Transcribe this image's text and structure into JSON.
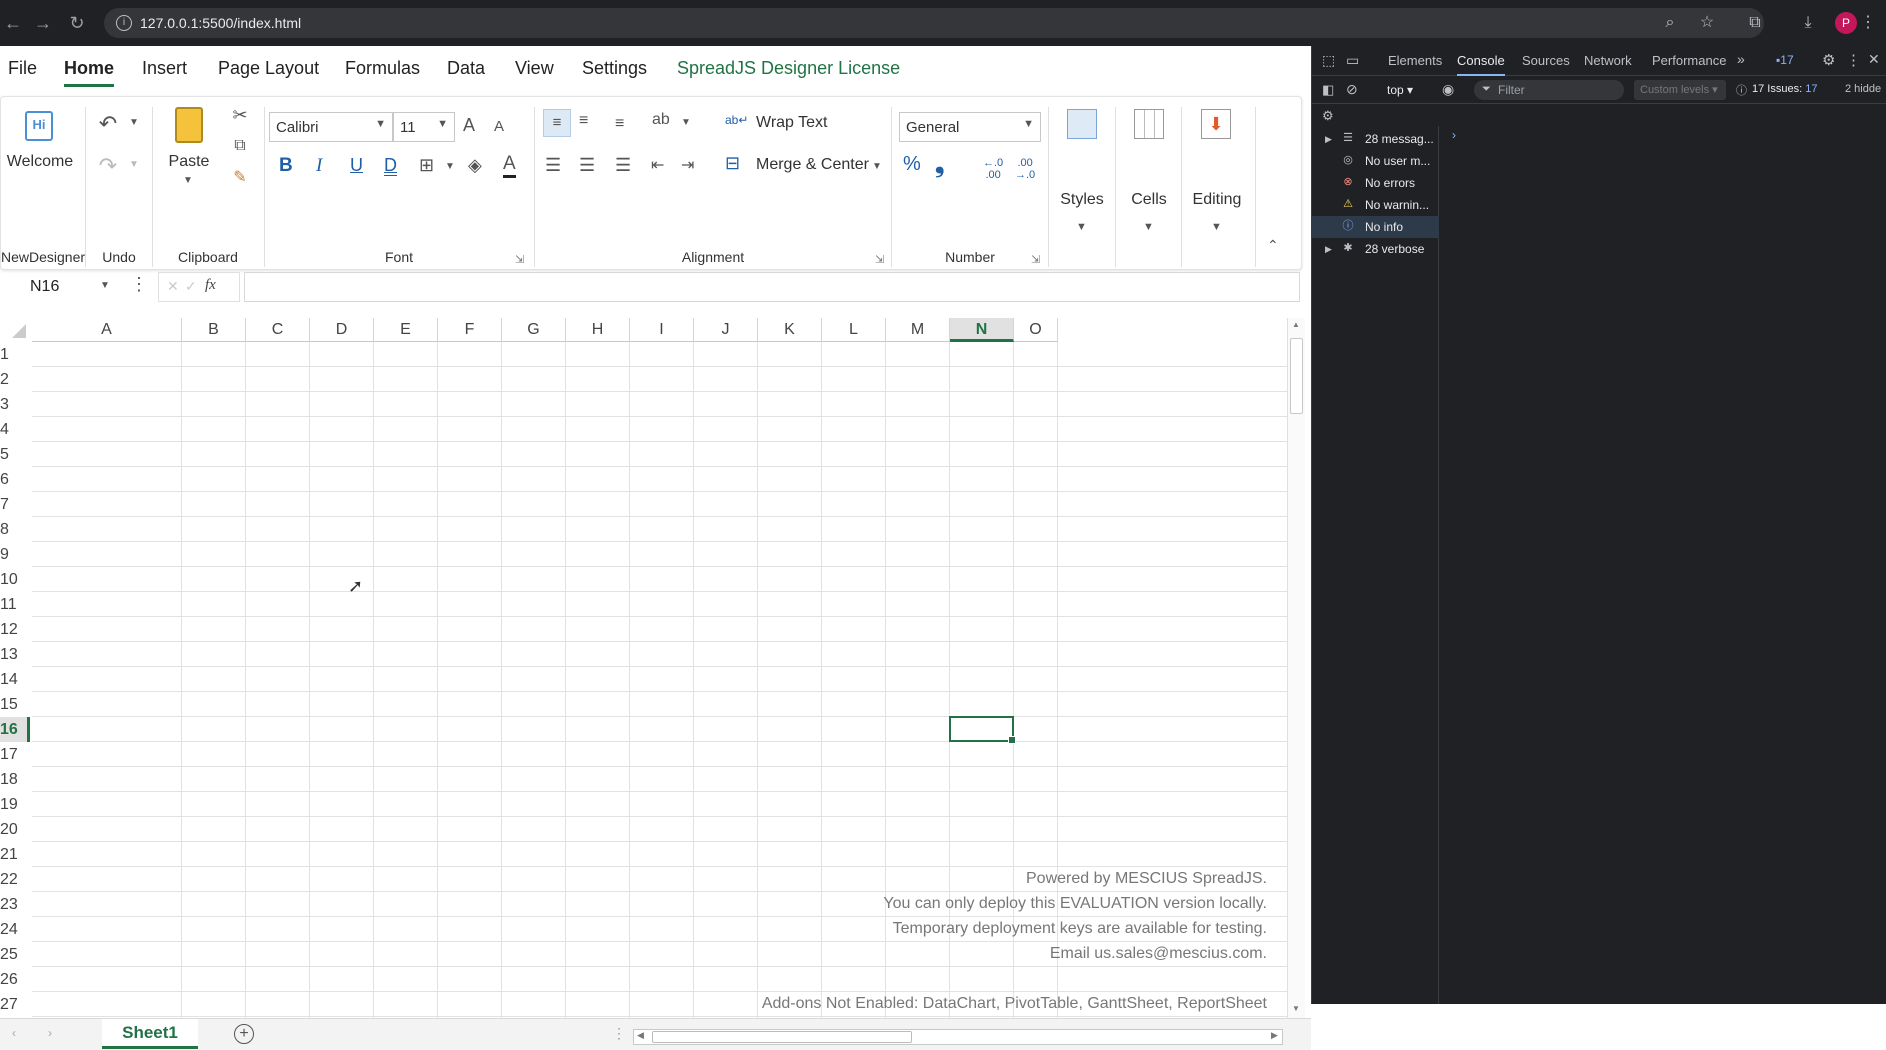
{
  "browser": {
    "url": "127.0.0.1:5500/index.html",
    "avatar_letter": "P"
  },
  "menu": {
    "tabs": [
      "File",
      "Home",
      "Insert",
      "Page Layout",
      "Formulas",
      "Data",
      "View",
      "Settings",
      "SpreadJS Designer License"
    ],
    "active": "Home"
  },
  "ribbon": {
    "groups": {
      "newdesigner": "NewDesigner",
      "undo": "Undo",
      "clipboard": "Clipboard",
      "font": "Font",
      "alignment": "Alignment",
      "number": "Number"
    },
    "welcome": "Welcome",
    "welcome_icon_text": "Hi",
    "paste": "Paste",
    "font_name": "Calibri",
    "font_size": "11",
    "bold": "B",
    "italic": "I",
    "underline": "U",
    "double_underline": "D",
    "font_color_letter": "A",
    "grow_font": "A",
    "shrink_font": "A",
    "wrap_text": "Wrap Text",
    "merge_center": "Merge & Center",
    "number_format": "General",
    "percent": "%",
    "comma": "❟",
    "styles": "Styles",
    "cells": "Cells",
    "editing": "Editing"
  },
  "formula_bar": {
    "name_box": "N16",
    "fx": "fx",
    "formula": ""
  },
  "grid": {
    "columns": [
      "A",
      "B",
      "C",
      "D",
      "E",
      "F",
      "G",
      "H",
      "I",
      "J",
      "K",
      "L",
      "M",
      "N",
      "O"
    ],
    "rows": [
      "1",
      "2",
      "3",
      "4",
      "5",
      "6",
      "7",
      "8",
      "9",
      "10",
      "11",
      "12",
      "13",
      "14",
      "15",
      "16",
      "17",
      "18",
      "19",
      "20",
      "21",
      "22",
      "23",
      "24",
      "25",
      "26",
      "27"
    ],
    "selected_cell": "N16",
    "selected_column": "N",
    "selected_row": "16"
  },
  "watermark": {
    "line1": "Powered by MESCIUS SpreadJS.",
    "line2": "You can only deploy this EVALUATION version locally.",
    "line3": "Temporary deployment keys are available for testing.",
    "line4": "Email us.sales@mescius.com.",
    "line5": "Add-ons Not Enabled: DataChart, PivotTable, GanttSheet, ReportSheet"
  },
  "sheets": {
    "active": "Sheet1"
  },
  "devtools": {
    "tabs": [
      "Elements",
      "Console",
      "Sources",
      "Network",
      "Performance"
    ],
    "active_tab": "Console",
    "issues_badge": "17",
    "context": "top",
    "filter_placeholder": "Filter",
    "levels": "Custom levels",
    "issues_text": "17 Issues:",
    "issues_count": "17",
    "hidden_text": "2 hidde",
    "sidebar": [
      {
        "label": "28 messag...",
        "icon": "list-icon",
        "expandable": true
      },
      {
        "label": "No user m...",
        "icon": "user-icon",
        "expandable": false
      },
      {
        "label": "No errors",
        "icon": "error-icon",
        "expandable": false
      },
      {
        "label": "No warnin...",
        "icon": "warning-icon",
        "expandable": false
      },
      {
        "label": "No info",
        "icon": "info-icon",
        "expandable": false
      },
      {
        "label": "28 verbose",
        "icon": "bug-icon",
        "expandable": true
      }
    ],
    "colors": {
      "error": "#f28b82",
      "warning": "#fdd663",
      "info": "#8ab4f8"
    }
  },
  "colors": {
    "accent": "#217346"
  }
}
